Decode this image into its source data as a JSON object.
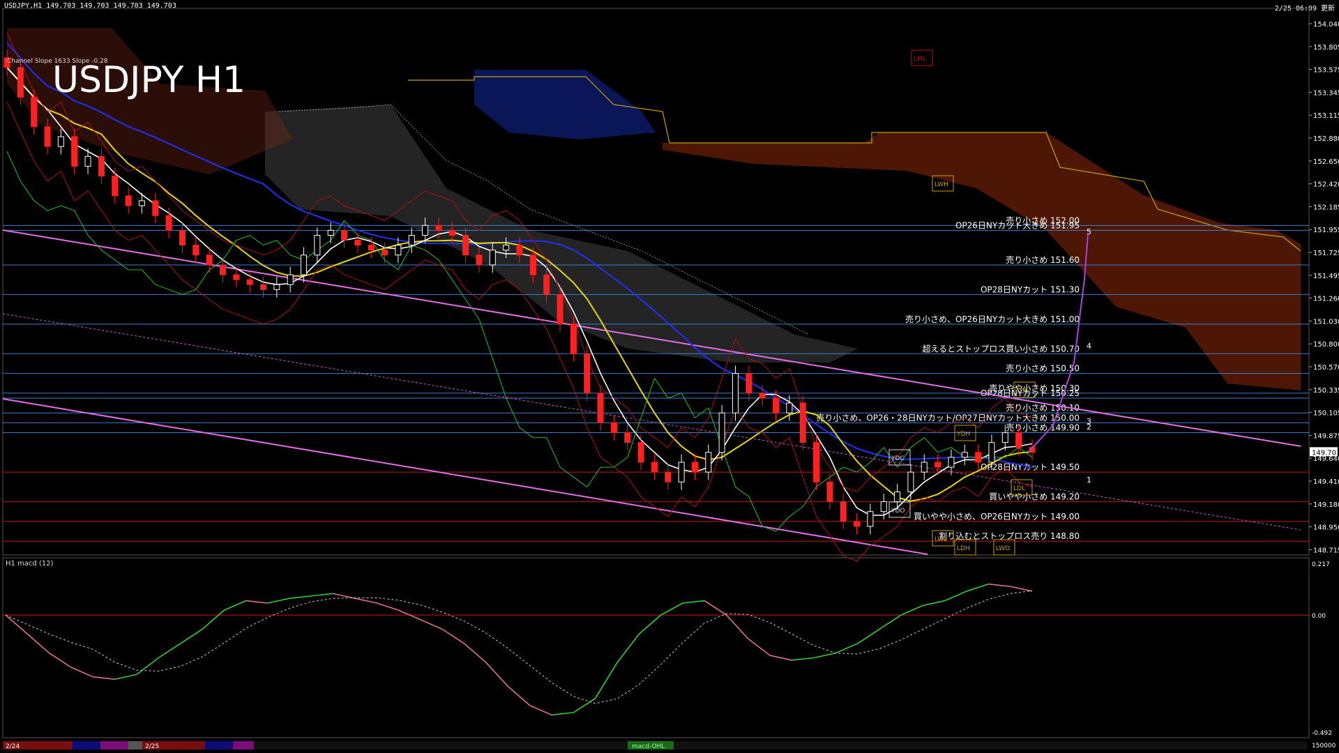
{
  "header": {
    "symbol_info": "USDJPY,H1  149.703 149.703 149.703 149.703",
    "timestamp": "2/25 06:09 更新",
    "channel_info": "Channel Slope 1633 Slope -0.28"
  },
  "chart_title": "USDJPY H1",
  "price_axis": {
    "labels": [
      "154.040",
      "153.805",
      "153.575",
      "153.345",
      "153.115",
      "152.880",
      "152.650",
      "152.420",
      "152.185",
      "151.955",
      "151.725",
      "151.495",
      "151.260",
      "151.030",
      "150.800",
      "150.570",
      "150.335",
      "150.105",
      "149.875",
      "149.640",
      "149.410",
      "149.180",
      "148.950",
      "148.715"
    ],
    "current_price": "149.703"
  },
  "levels": [
    {
      "price": 152.0,
      "text": "売り小さめ 152.00",
      "color": "#3a7fd5"
    },
    {
      "price": 151.95,
      "text": "OP26日NYカット大きめ 151.95",
      "color": "#3a7fd5"
    },
    {
      "price": 151.6,
      "text": "売り小さめ 151.60",
      "color": "#3a7fd5"
    },
    {
      "price": 151.3,
      "text": "OP28日NYカット 151.30",
      "color": "#3a7fd5"
    },
    {
      "price": 151.0,
      "text": "売り小さめ、OP26日NYカット大きめ 151.00",
      "color": "#3a7fd5"
    },
    {
      "price": 150.7,
      "text": "超えるとストップロス買い小さめ 150.70",
      "color": "#3a7fd5"
    },
    {
      "price": 150.5,
      "text": "売り小さめ 150.50",
      "color": "#3a7fd5"
    },
    {
      "price": 150.3,
      "text": "売りやや小さめ 150.30",
      "color": "#3a7fd5"
    },
    {
      "price": 150.25,
      "text": "OP28日NYカット 150.25",
      "color": "#3a7fd5"
    },
    {
      "price": 150.1,
      "text": "売り小さめ 150.10",
      "color": "#3a7fd5"
    },
    {
      "price": 150.0,
      "text": "売り小さめ、OP26・28日NYカット/OP27日NYカット大きめ 150.00",
      "color": "#3a7fd5"
    },
    {
      "price": 149.9,
      "text": "売り小さめ 149.90",
      "color": "#3a7fd5"
    },
    {
      "price": 149.5,
      "text": "OP28日NYカット 149.50",
      "color": "#c81818"
    },
    {
      "price": 149.2,
      "text": "買いやや小さめ 149.20",
      "color": "#c81818"
    },
    {
      "price": 149.0,
      "text": "買いやや小さめ、OP26日NYカット 149.00",
      "color": "#c81818"
    },
    {
      "price": 148.8,
      "text": "割り込むとストップロス売り 148.80",
      "color": "#c81818"
    }
  ],
  "tags": [
    "LML",
    "LWH",
    "YDH",
    "YDC",
    "YDO",
    "LWL",
    "YDL",
    "LDH",
    "LDL",
    "LWO"
  ],
  "projection_labels": [
    "5",
    "4",
    "3",
    "2",
    "1"
  ],
  "macd": {
    "label": "H1  macd (12)",
    "axis_top": "0.217",
    "axis_zero": "0.00",
    "axis_bottom": "-0.492",
    "bottom_value": "150000",
    "badge": "macd-OHL"
  },
  "time_axis": {
    "labels": [
      "2/24",
      "2/25"
    ]
  },
  "chart_data": {
    "type": "line",
    "title": "USDJPY H1",
    "ylim": [
      148.715,
      154.04
    ],
    "note_series": "approximate hourly closes, left to right",
    "series": [
      {
        "values": [
          153.6,
          153.3,
          153.0,
          152.8,
          152.9,
          152.6,
          152.7,
          152.5,
          152.3,
          152.2,
          152.25,
          152.1,
          151.95,
          151.8,
          151.7,
          151.6,
          151.5,
          151.45,
          151.4,
          151.35,
          151.4,
          151.5,
          151.7,
          151.9,
          151.95,
          151.85,
          151.8,
          151.75,
          151.7,
          151.8,
          151.9,
          152.0,
          151.95,
          151.9,
          151.7,
          151.6,
          151.75,
          151.8,
          151.7,
          151.5,
          151.3,
          151.0,
          150.7,
          150.3,
          150.0,
          149.9,
          149.8,
          149.6,
          149.5,
          149.4,
          149.6,
          149.5,
          149.7,
          150.1,
          150.5,
          150.3,
          150.25,
          150.1,
          150.2,
          149.8,
          149.4,
          149.2,
          149.0,
          148.95,
          149.1,
          149.2,
          149.3,
          149.5,
          149.6,
          149.55,
          149.65,
          149.7,
          149.6,
          149.8,
          149.9,
          149.75,
          149.7
        ]
      }
    ],
    "macd_series": [
      {
        "name": "macd",
        "values": [
          0.0,
          -0.08,
          -0.16,
          -0.22,
          -0.26,
          -0.27,
          -0.25,
          -0.18,
          -0.12,
          -0.06,
          0.02,
          0.06,
          0.05,
          0.07,
          0.08,
          0.09,
          0.07,
          0.05,
          0.02,
          -0.02,
          -0.06,
          -0.12,
          -0.2,
          -0.3,
          -0.38,
          -0.42,
          -0.41,
          -0.35,
          -0.2,
          -0.08,
          0.0,
          0.05,
          0.06,
          0.0,
          -0.1,
          -0.17,
          -0.19,
          -0.18,
          -0.16,
          -0.12,
          -0.06,
          0.0,
          0.04,
          0.06,
          0.1,
          0.13,
          0.12,
          0.1
        ]
      }
    ]
  }
}
